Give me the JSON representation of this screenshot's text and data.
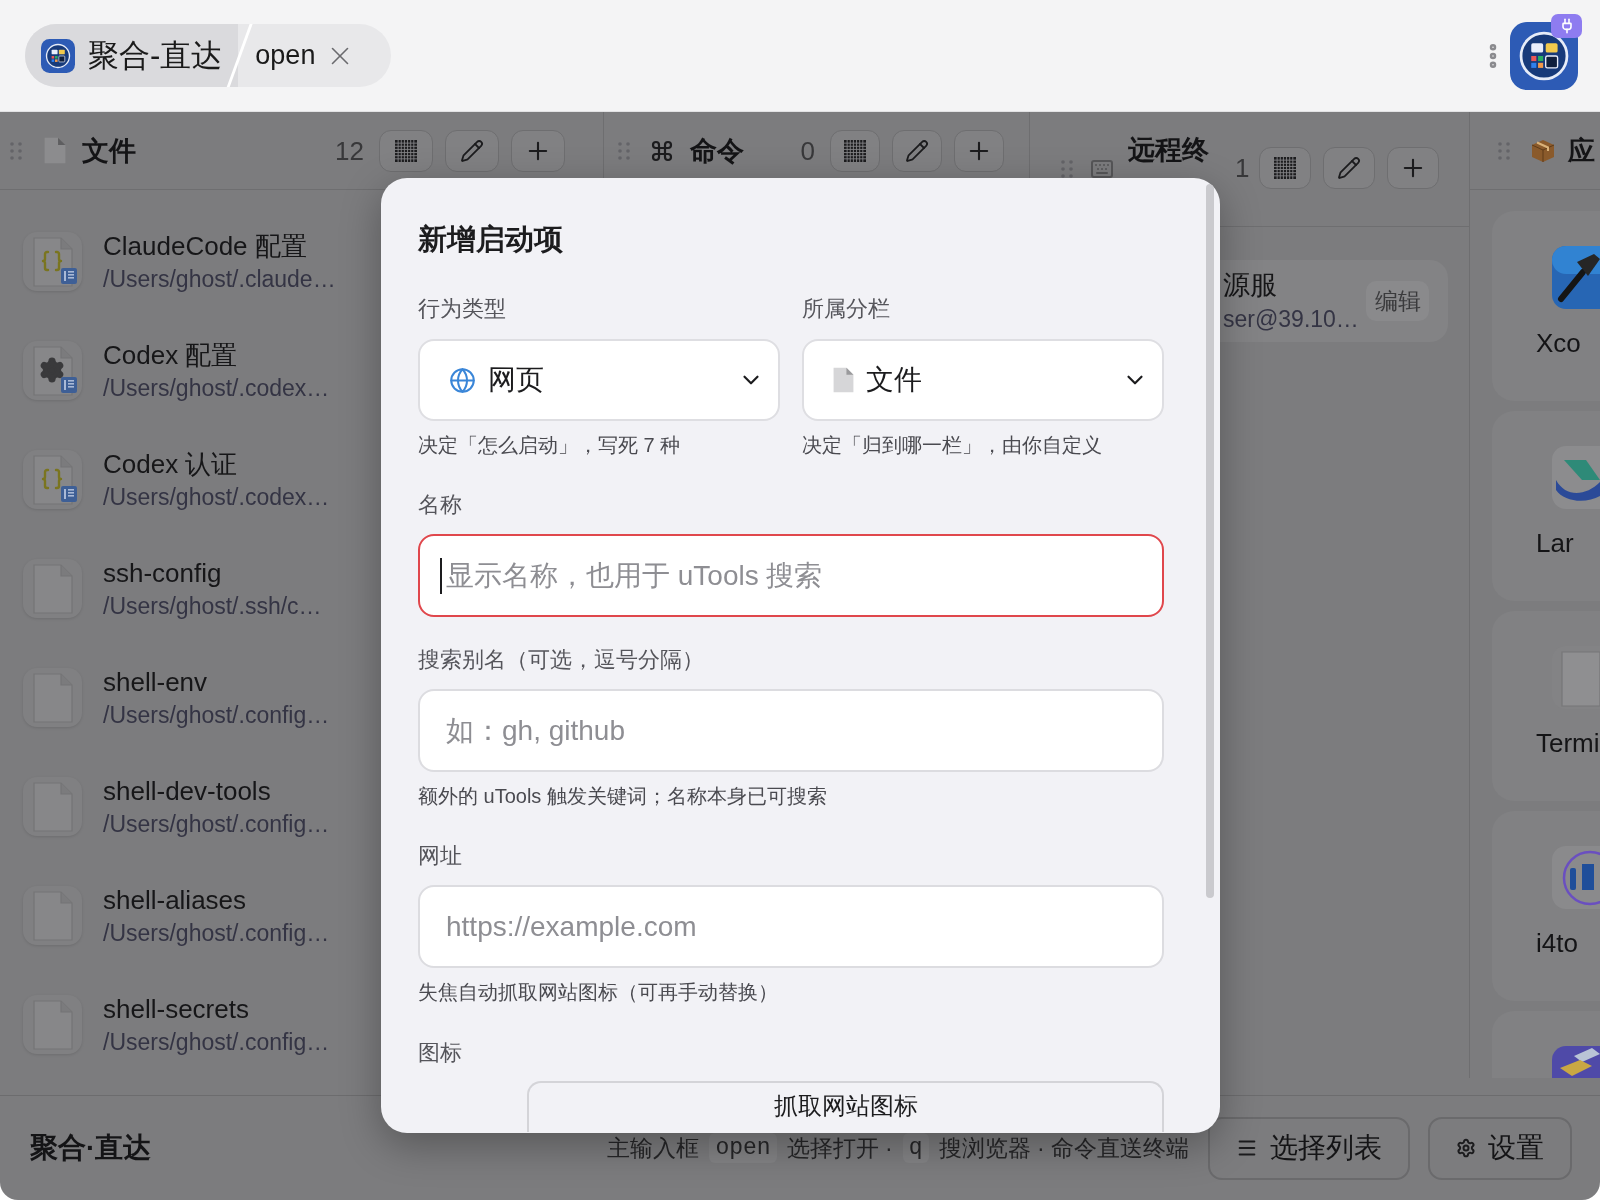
{
  "search_bar": {
    "plugin": "聚合-直达",
    "value": "open"
  },
  "columns": [
    {
      "kind": "files",
      "title": "文件",
      "count": "12",
      "items": [
        {
          "kind": "json",
          "title": "ClaudeCode 配置",
          "path": "/Users/ghost/.claude…"
        },
        {
          "kind": "settings",
          "title": "Codex 配置",
          "path": "/Users/ghost/.codex…"
        },
        {
          "kind": "json",
          "title": "Codex 认证",
          "path": "/Users/ghost/.codex…"
        },
        {
          "kind": "plain",
          "title": "ssh-config",
          "path": "/Users/ghost/.ssh/c…"
        },
        {
          "kind": "plain",
          "title": "shell-env",
          "path": "/Users/ghost/.config…"
        },
        {
          "kind": "plain",
          "title": "shell-dev-tools",
          "path": "/Users/ghost/.config…"
        },
        {
          "kind": "plain",
          "title": "shell-aliases",
          "path": "/Users/ghost/.config…"
        },
        {
          "kind": "plain",
          "title": "shell-secrets",
          "path": "/Users/ghost/.config…"
        }
      ]
    },
    {
      "kind": "commands",
      "title": "命令",
      "count": "0"
    },
    {
      "kind": "remote",
      "title": "远程终",
      "count": "1",
      "items": [
        {
          "title": "源服",
          "subtitle": "ser@39.10…",
          "action": "编辑"
        }
      ]
    },
    {
      "kind": "apps",
      "title": "应",
      "items": [
        {
          "kind": "hammer",
          "label": "Xco"
        },
        {
          "kind": "swoosh",
          "label": "Lar"
        },
        {
          "kind": "document",
          "label": "Termi"
        },
        {
          "kind": "ring",
          "label": "i4to"
        },
        {
          "kind": "books"
        }
      ]
    }
  ],
  "dialog": {
    "title": "新增启动项",
    "selects": [
      {
        "kind": "web",
        "label": "行为类型",
        "value": "网页",
        "hint": "决定「怎么启动」，写死 7 种"
      },
      {
        "kind": "file",
        "label": "所属分栏",
        "value": "文件",
        "hint": "决定「归到哪一栏」，由你自定义"
      }
    ],
    "fields": [
      {
        "label": "名称",
        "placeholder": "显示名称，也用于 uTools 搜索",
        "invalid": true,
        "focused": true
      },
      {
        "label": "搜索别名（可选，逗号分隔）",
        "placeholder": "如：gh, github",
        "hint": "额外的 uTools 触发关键词；名称本身已可搜索",
        "invalid": false,
        "focused": false
      },
      {
        "label": "网址",
        "placeholder": "https://example.com",
        "hint": "失焦自动抓取网站图标（可再手动替换）",
        "invalid": false,
        "focused": false
      }
    ],
    "icon_field": {
      "label": "图标",
      "button": "抓取网站图标"
    }
  },
  "footer": {
    "title": "聚合·直达",
    "hint": [
      {
        "kind": "text",
        "text": "主输入框"
      },
      {
        "kind": "key",
        "text": "open"
      },
      {
        "kind": "text",
        "text": "选择打开 ·"
      },
      {
        "kind": "key",
        "text": "q"
      },
      {
        "kind": "text",
        "text": "搜浏览器 · 命令直送终端"
      }
    ],
    "buttons": [
      {
        "kind": "list",
        "label": "选择列表"
      },
      {
        "kind": "settings",
        "label": "设置"
      }
    ]
  }
}
